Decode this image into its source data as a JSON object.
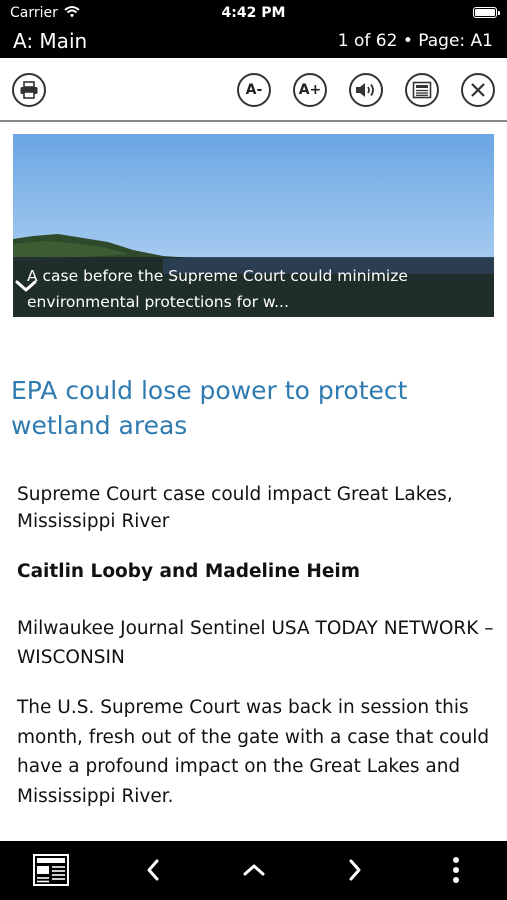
{
  "status": {
    "carrier": "Carrier",
    "time": "4:42 PM"
  },
  "header": {
    "section": "A: Main",
    "page_info": "1 of 62 • Page: A1"
  },
  "toolbar": {
    "text_smaller_label": "A-",
    "text_larger_label": "A+"
  },
  "article": {
    "image_caption": "A case before the Supreme Court could minimize environmental protections for w...",
    "headline": "EPA could lose power to protect wetland areas",
    "subheadline": "Supreme Court case could impact Great Lakes, Mississippi River",
    "byline": "Caitlin Looby and Madeline Heim",
    "source": "Milwaukee Journal Sentinel USA TODAY NETWORK – WISCONSIN",
    "paragraph_1": "The U.S. Supreme Court was back in session this month, fresh out of the gate with a case that could have a profound impact on the Great Lakes and Mississippi River."
  },
  "colors": {
    "headline": "#2f7bb0",
    "bars": "#000000"
  }
}
